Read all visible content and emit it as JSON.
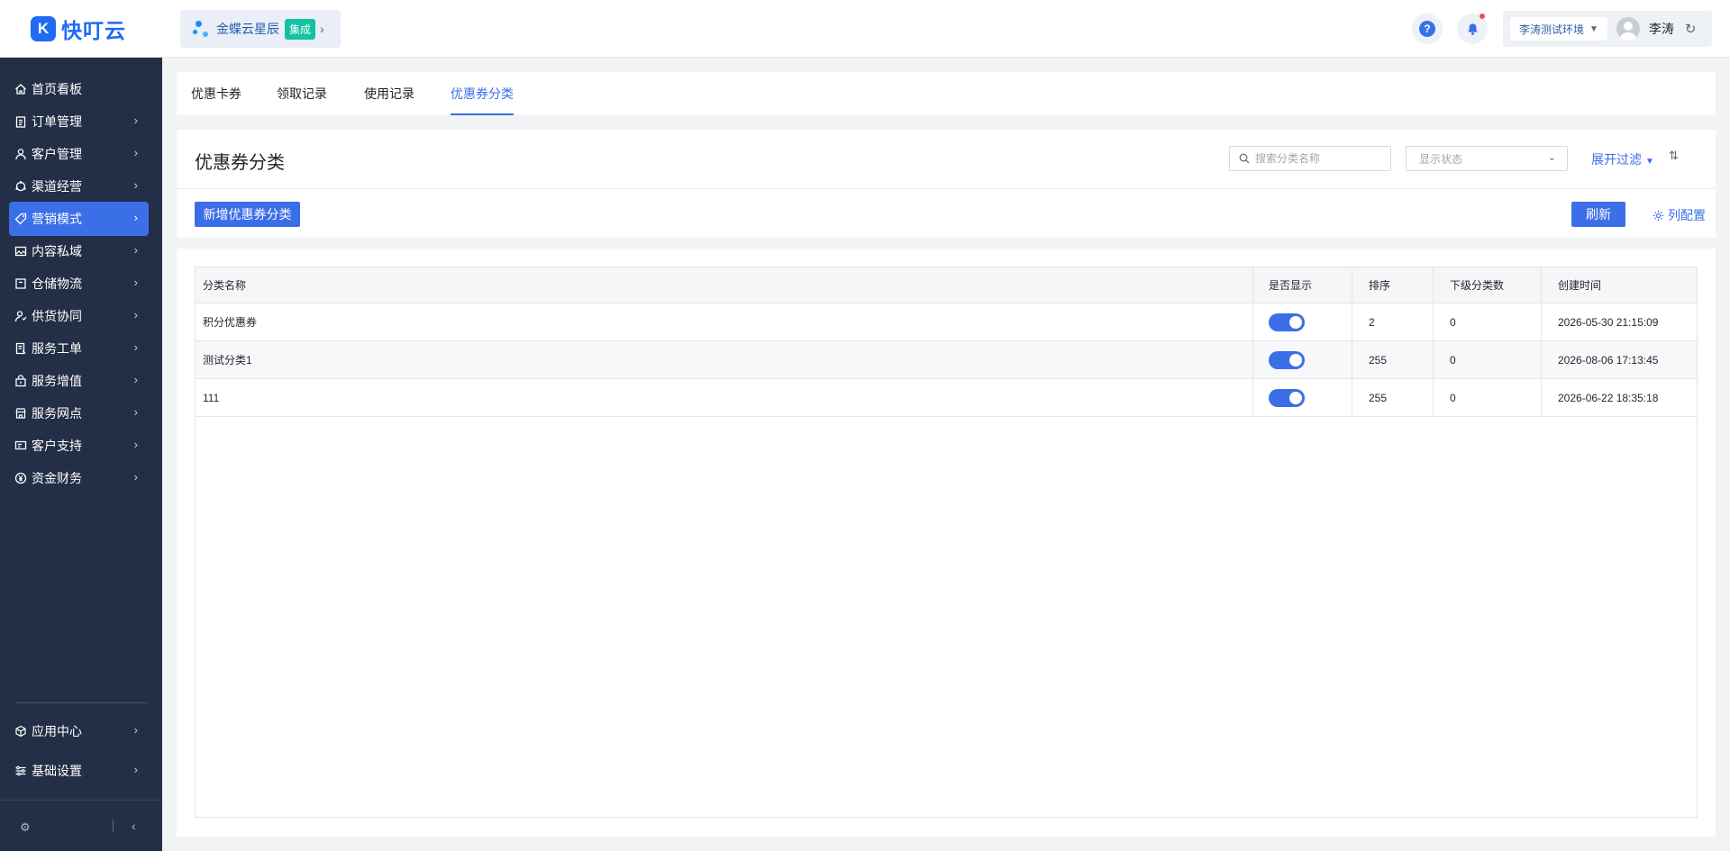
{
  "app": {
    "logo_mark": "K",
    "logo_text": "快叮云"
  },
  "header": {
    "product_name": "金蝶云星辰",
    "product_tag": "集成",
    "help_label": "?",
    "environment": "李涛测试环境",
    "user_name": "李涛"
  },
  "sidebar": {
    "items": [
      {
        "label": "首页看板",
        "icon": "home-icon",
        "has_children": false
      },
      {
        "label": "订单管理",
        "icon": "clipboard-icon",
        "has_children": true
      },
      {
        "label": "客户管理",
        "icon": "user-icon",
        "has_children": true
      },
      {
        "label": "渠道经营",
        "icon": "channel-icon",
        "has_children": true
      },
      {
        "label": "营销模式",
        "icon": "tag-icon",
        "has_children": true,
        "active": true
      },
      {
        "label": "内容私域",
        "icon": "image-icon",
        "has_children": true
      },
      {
        "label": "仓储物流",
        "icon": "box-icon",
        "has_children": true
      },
      {
        "label": "供货协同",
        "icon": "supply-icon",
        "has_children": true
      },
      {
        "label": "服务工单",
        "icon": "ticket-icon",
        "has_children": true
      },
      {
        "label": "服务增值",
        "icon": "bag-icon",
        "has_children": true
      },
      {
        "label": "服务网点",
        "icon": "store-icon",
        "has_children": true
      },
      {
        "label": "客户支持",
        "icon": "support-icon",
        "has_children": true
      },
      {
        "label": "资金财务",
        "icon": "yuan-icon",
        "has_children": true
      }
    ],
    "bottom_items": [
      {
        "label": "应用中心",
        "icon": "cube-icon",
        "has_children": true
      },
      {
        "label": "基础设置",
        "icon": "sliders-icon",
        "has_children": true
      }
    ]
  },
  "tabs": [
    {
      "label": "优惠卡券",
      "active": false
    },
    {
      "label": "领取记录",
      "active": false
    },
    {
      "label": "使用记录",
      "active": false
    },
    {
      "label": "优惠券分类",
      "active": true
    }
  ],
  "page": {
    "title": "优惠券分类",
    "search_placeholder": "搜索分类名称",
    "status_placeholder": "显示状态",
    "expand_filter": "展开过滤",
    "add_button": "新增优惠券分类",
    "refresh_button": "刷新",
    "column_config": "列配置"
  },
  "table": {
    "columns": [
      "分类名称",
      "是否显示",
      "排序",
      "下级分类数",
      "创建时间"
    ],
    "rows": [
      {
        "name": "积分优惠券",
        "visible": true,
        "sort": "2",
        "children": "0",
        "created": "2026-05-30 21:15:09"
      },
      {
        "name": "测试分类1",
        "visible": true,
        "sort": "255",
        "children": "0",
        "created": "2026-08-06 17:13:45"
      },
      {
        "name": "111",
        "visible": true,
        "sort": "255",
        "children": "0",
        "created": "2026-06-22 18:35:18"
      }
    ]
  },
  "colors": {
    "primary": "#3b6fe8",
    "sidebar_bg": "#232f47",
    "tag_green": "#13c2a2",
    "notify_red": "#f54a45"
  }
}
